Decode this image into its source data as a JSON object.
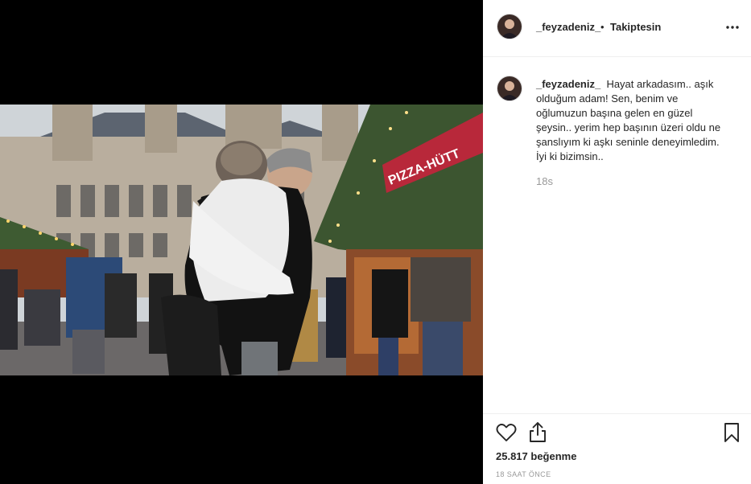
{
  "post": {
    "username": "_feyzadeniz_",
    "separator": "•",
    "follow_status": "Takiptesin",
    "caption_text": "Hayat arkadasım.. aşık olduğum adam! Sen, benim ve oğlumuzun başına gelen en güzel şeysin.. yerim hep başının üzeri oldu ne şanslıyım ki aşkı seninle deneyimledim. İyi ki bizimsin..",
    "caption_time": "18s",
    "likes": "25.817 beğenme",
    "post_time": "18 SAAT ÖNCE",
    "sign_text": "PIZZA-HÜTT"
  },
  "icons": {
    "more": "more-options-icon",
    "like": "heart-icon",
    "share": "share-icon",
    "save": "bookmark-icon"
  }
}
